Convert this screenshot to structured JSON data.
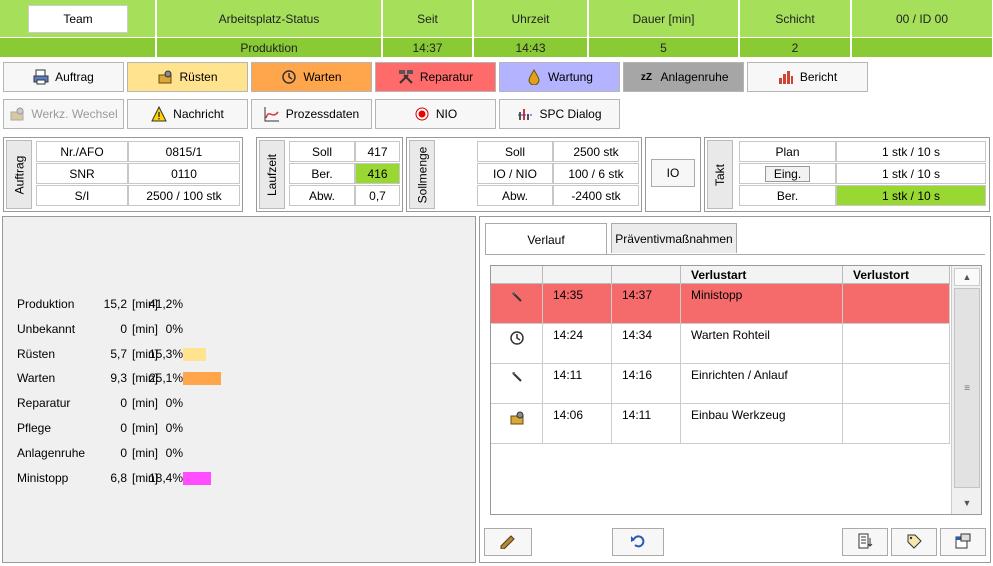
{
  "header": {
    "team_button": "Team",
    "columns": [
      {
        "label": "Arbeitsplatz-Status",
        "value": "Produktion"
      },
      {
        "label": "Seit",
        "value": "14:37"
      },
      {
        "label": "Uhrzeit",
        "value": "14:43"
      },
      {
        "label": "Dauer [min]",
        "value": "5"
      },
      {
        "label": "Schicht",
        "value": "2"
      },
      {
        "label": "00  / ID 00",
        "value": ""
      }
    ]
  },
  "toolbar1": [
    {
      "label": "Auftrag",
      "icon": "printer-icon",
      "color": "#f7f7f7"
    },
    {
      "label": "Rüsten",
      "icon": "setup-icon",
      "color": "#ffe38f"
    },
    {
      "label": "Warten",
      "icon": "wait-icon",
      "color": "#ffa64d"
    },
    {
      "label": "Reparatur",
      "icon": "tools-icon",
      "color": "#ff6b6b"
    },
    {
      "label": "Wartung",
      "icon": "oil-drop-icon",
      "color": "#b3b3ff"
    },
    {
      "label": "Anlagenruhe",
      "icon": "sleep-icon",
      "color": "#a6a6a6"
    },
    {
      "label": "Bericht",
      "icon": "report-icon",
      "color": "#f7f7f7"
    }
  ],
  "toolbar2": [
    {
      "label": "Werkz. Wechsel",
      "icon": "tool-change-icon",
      "disabled": true
    },
    {
      "label": "Nachricht",
      "icon": "warning-icon",
      "disabled": false
    },
    {
      "label": "Prozessdaten",
      "icon": "chart-icon",
      "disabled": false
    },
    {
      "label": "NIO",
      "icon": "record-icon",
      "disabled": false
    },
    {
      "label": "SPC Dialog",
      "icon": "spc-icon",
      "disabled": false
    }
  ],
  "auftrag": {
    "title": "Auftrag",
    "rows": [
      [
        "Nr./AFO",
        "0815/1"
      ],
      [
        "SNR",
        "0110"
      ],
      [
        "S/I",
        "2500  / 100 stk"
      ]
    ]
  },
  "laufzeit": {
    "title": "Laufzeit",
    "rows": [
      [
        "Soll",
        "417"
      ],
      [
        "Ber.",
        "416"
      ],
      [
        "Abw.",
        "0,7"
      ]
    ]
  },
  "sollmenge": {
    "title": "Sollmenge",
    "rows": [
      [
        "Soll",
        "2500 stk"
      ],
      [
        "IO / NIO",
        "100  / 6 stk"
      ],
      [
        "Abw.",
        "-2400 stk"
      ]
    ]
  },
  "io_button": "IO",
  "takt": {
    "title": "Takt",
    "rows": [
      [
        "Plan",
        "1 stk  / 10 s"
      ],
      [
        "Eing.",
        "1 stk  / 10 s"
      ],
      [
        "Ber.",
        "1  stk  / 10 s"
      ]
    ]
  },
  "breakdown": [
    {
      "label": "Produktion",
      "value": "15,2",
      "unit": "[min]",
      "pct": "41,2%",
      "fraction": 0.412,
      "color": ""
    },
    {
      "label": "Unbekannt",
      "value": "0",
      "unit": "[min]",
      "pct": "0%",
      "fraction": 0,
      "color": ""
    },
    {
      "label": "Rüsten",
      "value": "5,7",
      "unit": "[min]",
      "pct": "15,3%",
      "fraction": 0.153,
      "color": "#ffe38f"
    },
    {
      "label": "Warten",
      "value": "9,3",
      "unit": "[min]",
      "pct": "25,1%",
      "fraction": 0.251,
      "color": "#ffa64d"
    },
    {
      "label": "Reparatur",
      "value": "0",
      "unit": "[min]",
      "pct": "0%",
      "fraction": 0,
      "color": ""
    },
    {
      "label": "Pflege",
      "value": "0",
      "unit": "[min]",
      "pct": "0%",
      "fraction": 0,
      "color": ""
    },
    {
      "label": "Anlagenruhe",
      "value": "0",
      "unit": "[min]",
      "pct": "0%",
      "fraction": 0,
      "color": ""
    },
    {
      "label": "Ministopp",
      "value": "6,8",
      "unit": "[min]",
      "pct": "18,4%",
      "fraction": 0.184,
      "color": "#ff4dff"
    }
  ],
  "tabs": [
    {
      "label": "Verlauf",
      "active": true
    },
    {
      "label": "Präventivmaßnahmen",
      "active": false
    }
  ],
  "history": {
    "headers": [
      "",
      "",
      "",
      "Verlustart",
      "Verlustort"
    ],
    "rows": [
      {
        "icon": "pin-icon",
        "from": "14:35",
        "to": "14:37",
        "type": "Ministopp",
        "place": "",
        "highlight": true
      },
      {
        "icon": "wait-icon",
        "from": "14:24",
        "to": "14:34",
        "type": "Warten Rohteil",
        "place": "",
        "highlight": false
      },
      {
        "icon": "pin-icon",
        "from": "14:11",
        "to": "14:16",
        "type": "Einrichten / Anlauf",
        "place": "",
        "highlight": false
      },
      {
        "icon": "setup-icon",
        "from": "14:06",
        "to": "14:11",
        "type": "Einbau Werkzeug",
        "place": "",
        "highlight": false
      }
    ]
  },
  "bottom_buttons": [
    "edit-icon",
    "undo-icon",
    "export-icon",
    "tag-icon",
    "window-icon"
  ]
}
